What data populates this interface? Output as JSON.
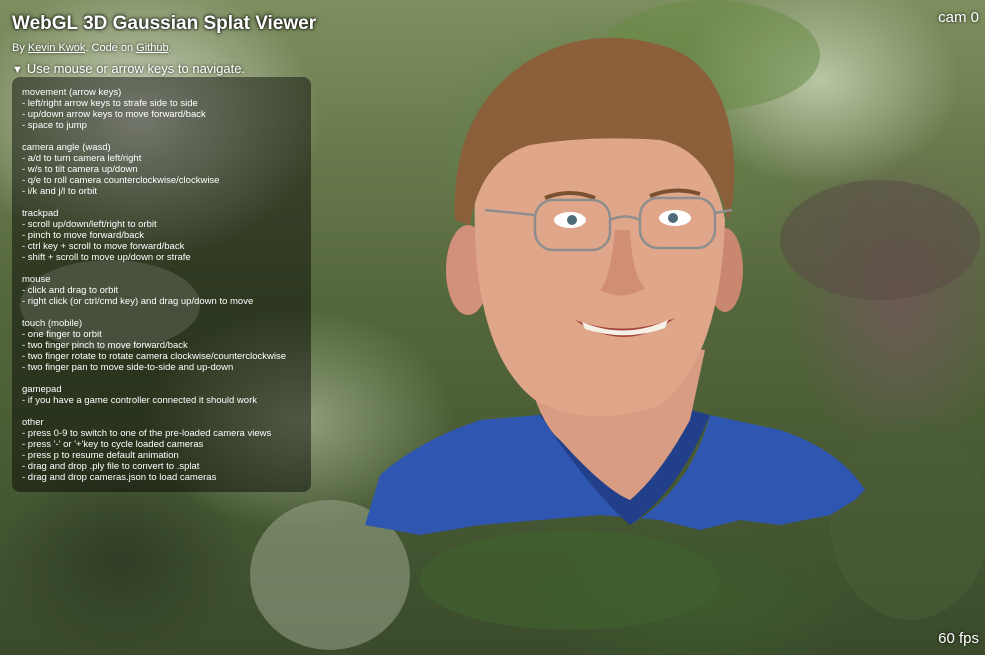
{
  "header": {
    "title": "WebGL 3D Gaussian Splat Viewer",
    "by_prefix": "By ",
    "author": "Kevin Kwok",
    "code_prefix": ". Code on ",
    "code_link": "Github",
    "code_suffix": "."
  },
  "nav_toggle": {
    "icon": "triangle-down-icon",
    "label": "Use mouse or arrow keys to navigate."
  },
  "help": {
    "sections": [
      {
        "heading": "movement (arrow keys)",
        "lines": [
          "- left/right arrow keys to strafe side to side",
          "- up/down arrow keys to move forward/back",
          "- space to jump"
        ]
      },
      {
        "heading": "camera angle (wasd)",
        "lines": [
          "- a/d to turn camera left/right",
          "- w/s to tilt camera up/down",
          "- q/e to roll camera counterclockwise/clockwise",
          "- i/k and j/l to orbit"
        ]
      },
      {
        "heading": "trackpad",
        "lines": [
          "- scroll up/down/left/right to orbit",
          "- pinch to move forward/back",
          "- ctrl key + scroll to move forward/back",
          "- shift + scroll to move up/down or strafe"
        ]
      },
      {
        "heading": "mouse",
        "lines": [
          "- click and drag to orbit",
          "- right click (or ctrl/cmd key) and drag up/down to move"
        ]
      },
      {
        "heading": "touch (mobile)",
        "lines": [
          "- one finger to orbit",
          "- two finger pinch to move forward/back",
          "- two finger rotate to rotate camera clockwise/counterclockwise",
          "- two finger pan to move side-to-side and up-down"
        ]
      },
      {
        "heading": "gamepad",
        "lines": [
          "- if you have a game controller connected it should work"
        ]
      },
      {
        "heading": "other",
        "lines": [
          "- press 0-9 to switch to one of the pre-loaded camera views",
          "- press '-' or '+'key to cycle loaded cameras",
          "- press p to resume default animation",
          "- drag and drop .ply file to convert to .splat",
          "- drag and drop cameras.json to load cameras"
        ]
      }
    ]
  },
  "status": {
    "camera": "cam 0",
    "fps": "60 fps"
  },
  "colors": {
    "text": "#ffffff",
    "panel_bg": "rgba(0,0,0,0.45)",
    "shirt": "#2f56b0"
  }
}
